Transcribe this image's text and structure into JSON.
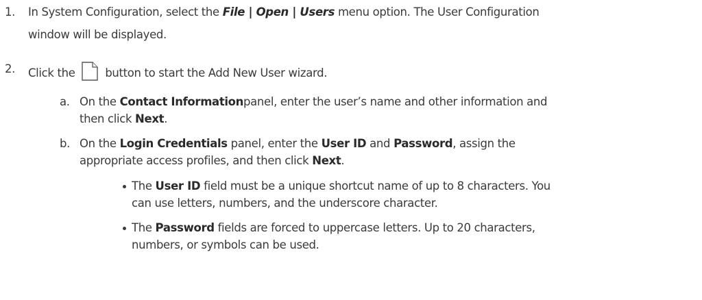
{
  "steps": [
    {
      "number": "1.",
      "line1": {
        "pre": "In System Configuration, select the ",
        "menu": [
          "File",
          "Open",
          "Users"
        ],
        "separator": " | ",
        "post": " menu option. The User Configuration"
      },
      "line2": "window will be displayed."
    },
    {
      "number": "2.",
      "pre": "Click the",
      "icon": "new-document-icon",
      "post": "button to start the Add New User wizard.",
      "substeps": [
        {
          "letter": "a.",
          "line1": {
            "pre": "On the ",
            "bold": "Contact Information",
            "post": "panel, enter the user’s name and other information and"
          },
          "line2": {
            "pre": "then click ",
            "bold": "Next",
            "post": "."
          }
        },
        {
          "letter": "b.",
          "line1": {
            "pre": "On the ",
            "bold1": "Login Credentials",
            "mid1": " panel, enter the ",
            "bold2": "User ID",
            "mid2": " and ",
            "bold3": "Password",
            "post": ", assign the"
          },
          "line2": {
            "pre": "appropriate access profiles, and then click ",
            "bold": "Next",
            "post": "."
          },
          "bullets": [
            {
              "line1": {
                "pre": "The ",
                "bold": "User ID",
                "post": " field must be a unique shortcut name of up to 8 characters. You"
              },
              "line2": "can use letters, numbers, and the underscore character."
            },
            {
              "line1": {
                "pre": "The ",
                "bold": "Password",
                "post": " fields are forced to uppercase letters. Up to 20 characters,"
              },
              "line2": "numbers, or symbols can be used."
            }
          ]
        }
      ]
    }
  ]
}
